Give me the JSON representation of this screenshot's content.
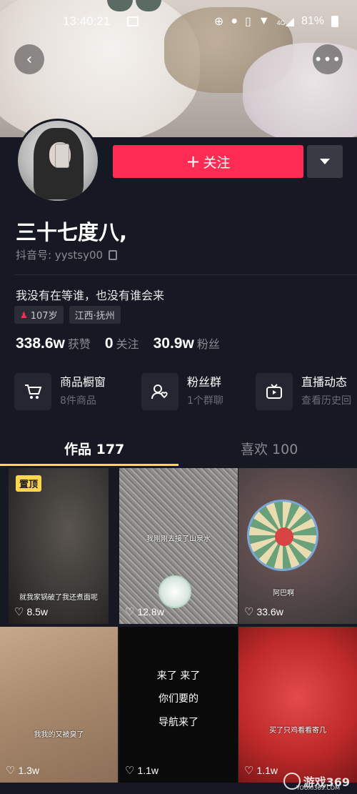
{
  "status_bar": {
    "time": "13:40:21",
    "network": "4G",
    "battery": "81%"
  },
  "profile": {
    "name": "三十七度八,",
    "douyin_id": "抖音号: yystsy00",
    "bio": "我没有在等谁，也没有谁会来",
    "tags": [
      {
        "text": "107岁",
        "icon": "person-icon"
      },
      {
        "text": "江西·抚州"
      }
    ],
    "follow_button": "关注",
    "stats": [
      {
        "num": "338.6w",
        "label": "获赞"
      },
      {
        "num": "0",
        "label": "关注"
      },
      {
        "num": "30.9w",
        "label": "粉丝"
      }
    ],
    "features": [
      {
        "title": "商品橱窗",
        "sub": "8件商品",
        "icon": "cart-icon"
      },
      {
        "title": "粉丝群",
        "sub": "1个群聊",
        "icon": "group-icon"
      },
      {
        "title": "直播动态",
        "sub": "查看历史回",
        "icon": "live-icon"
      }
    ]
  },
  "tabs": [
    {
      "label": "作品 177",
      "active": true
    },
    {
      "label": "喜欢 100",
      "active": false
    }
  ],
  "videos": [
    {
      "likes": "8.5w",
      "caption": "就我家锅破了我还煮面呢",
      "pinned": "置顶"
    },
    {
      "likes": "12.8w",
      "caption": "我刚刚去接了山泉水"
    },
    {
      "likes": "33.6w",
      "caption": "阿巴啊"
    },
    {
      "likes": "1.3w",
      "caption": "我我的又被臭了"
    },
    {
      "likes": "1.1w",
      "caption_lines": [
        "来了 来了",
        "你们要的",
        "导航来了"
      ]
    },
    {
      "likes": "1.1w",
      "caption": "买了只鸡看看寄几"
    }
  ],
  "watermark": {
    "text": "游戏369",
    "sub": "YOUXI369.COM"
  },
  "colors": {
    "accent": "#fe2c55",
    "tab_underline": "#fdd64d",
    "background": "#161823"
  }
}
